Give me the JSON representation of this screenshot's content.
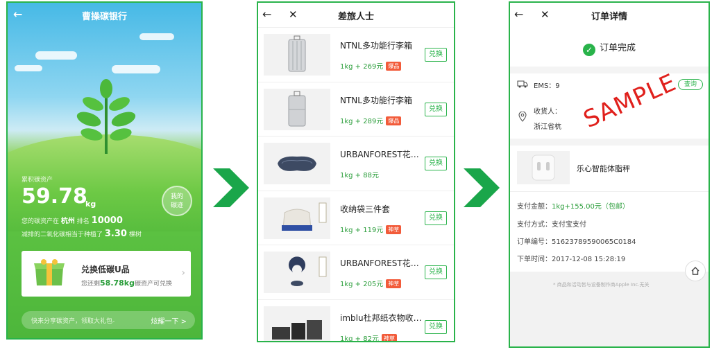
{
  "screen1": {
    "title": "曹操碳银行",
    "asset_label": "累积碳资产",
    "asset_value": "59.78",
    "asset_unit": "kg",
    "rank_prefix": "您的碳资产在",
    "rank_city": "杭州",
    "rank_middle": "排名",
    "rank_value": "10000",
    "trees_prefix": "减排的二氧化碳相当于种植了",
    "trees_value": "3.30",
    "trees_suffix": "棵树",
    "my_carbon_line1": "我的",
    "my_carbon_line2": "碳迹",
    "card_title": "兑换低碳U品",
    "card_sub_prefix": "您还剩",
    "card_sub_value": "58.78kg",
    "card_sub_suffix": "碳资产可兑换",
    "share_text": "快来分享碳资产，领取大礼包-",
    "share_button": "炫耀一下 >"
  },
  "screen2": {
    "title": "差旅人士",
    "redeem_label": "兑换",
    "items": [
      {
        "name": "NTNL多功能行李箱",
        "price": "1kg + 269元",
        "tag": "爆品",
        "icon": "suitcase-icon"
      },
      {
        "name": "NTNL多功能行李箱",
        "price": "1kg + 289元",
        "tag": "爆品",
        "icon": "suitcase-icon"
      },
      {
        "name": "URBANFOREST花园眼罩",
        "price": "1kg + 88元",
        "tag": "",
        "icon": "eye-mask-icon"
      },
      {
        "name": "收纳袋三件套",
        "price": "1kg + 119元",
        "tag": "神草",
        "icon": "storage-bag-icon"
      },
      {
        "name": "URBANFOREST花园颈枕",
        "price": "1kg + 205元",
        "tag": "神草",
        "icon": "neck-pillow-icon"
      },
      {
        "name": "imblu杜邦纸衣物收纳袋",
        "price": "1kg + 82元",
        "tag": "神草",
        "icon": "bag-set-icon"
      }
    ]
  },
  "screen3": {
    "title": "订单详情",
    "status": "订单完成",
    "ems_label": "EMS：9",
    "query_label": "查询",
    "receiver_label": "收货人：",
    "address": "浙江省杭",
    "stamp": "SAMPLE",
    "product_name": "乐心智能体脂秤",
    "pay_amount_label": "支付金额：",
    "pay_amount_value": "1kg+155.00元（包邮）",
    "pay_method_label": "支付方式：",
    "pay_method_value": "支付宝支付",
    "order_no_label": "订单编号：",
    "order_no_value": "51623789590065C0184",
    "order_time_label": "下单时间：",
    "order_time_value": "2017-12-08 15:28:19",
    "disclaimer": "* 商品和活动皆与设备制作商Apple Inc.无关"
  },
  "colors": {
    "brand_green": "#29b34a",
    "price_green": "#2a9d3a",
    "tag_red": "#f25b3a",
    "stamp_red": "#e0201c"
  }
}
